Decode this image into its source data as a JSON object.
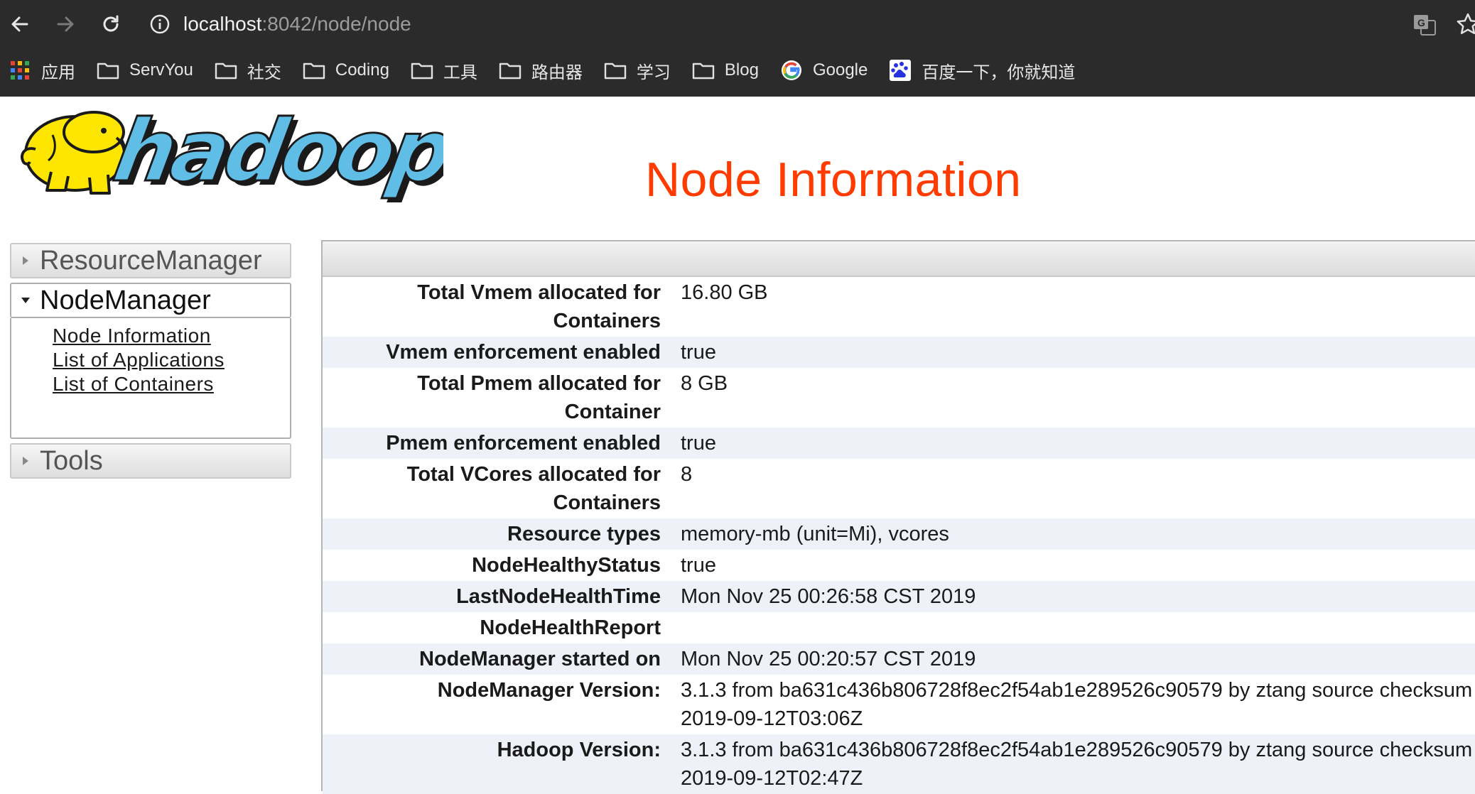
{
  "browser": {
    "url_host": "localhost",
    "url_rest": ":8042/node/node",
    "bookmarks": [
      {
        "label": "应用",
        "icon": "apps-grid-icon"
      },
      {
        "label": "ServYou",
        "icon": "folder-icon"
      },
      {
        "label": "社交",
        "icon": "folder-icon"
      },
      {
        "label": "Coding",
        "icon": "folder-icon"
      },
      {
        "label": "工具",
        "icon": "folder-icon"
      },
      {
        "label": "路由器",
        "icon": "folder-icon"
      },
      {
        "label": "学习",
        "icon": "folder-icon"
      },
      {
        "label": "Blog",
        "icon": "folder-icon"
      },
      {
        "label": "Google",
        "icon": "google-icon"
      },
      {
        "label": "百度一下，你就知道",
        "icon": "baidu-icon"
      }
    ]
  },
  "logo_text": "hadoop",
  "page_title": "Node Information",
  "nav": {
    "resource_manager": "ResourceManager",
    "node_manager": "NodeManager",
    "links": [
      "Node Information",
      "List of Applications",
      "List of Containers"
    ],
    "tools": "Tools"
  },
  "info_rows": [
    {
      "key": "Total Vmem allocated for Containers",
      "value": "16.80 GB"
    },
    {
      "key": "Vmem enforcement enabled",
      "value": "true"
    },
    {
      "key": "Total Pmem allocated for Container",
      "value": "8 GB"
    },
    {
      "key": "Pmem enforcement enabled",
      "value": "true"
    },
    {
      "key": "Total VCores allocated for Containers",
      "value": "8"
    },
    {
      "key": "Resource types",
      "value": "memory-mb (unit=Mi), vcores"
    },
    {
      "key": "NodeHealthyStatus",
      "value": "true"
    },
    {
      "key": "LastNodeHealthTime",
      "value": "Mon Nov 25 00:26:58 CST 2019"
    },
    {
      "key": "NodeHealthReport",
      "value": ""
    },
    {
      "key": "NodeManager started on",
      "value": "Mon Nov 25 00:20:57 CST 2019"
    },
    {
      "key": "NodeManager Version:",
      "value": "3.1.3 from ba631c436b806728f8ec2f54ab1e289526c90579 by ztang source checksum",
      "value2": "2019-09-12T03:06Z"
    },
    {
      "key": "Hadoop Version:",
      "value": "3.1.3 from ba631c436b806728f8ec2f54ab1e289526c90579 by ztang source checksum",
      "value2": "2019-09-12T02:47Z"
    }
  ],
  "colors": {
    "title": "#ff3b00",
    "chrome_bg": "#2b2b2b",
    "row_alt": "#eef1f8"
  }
}
